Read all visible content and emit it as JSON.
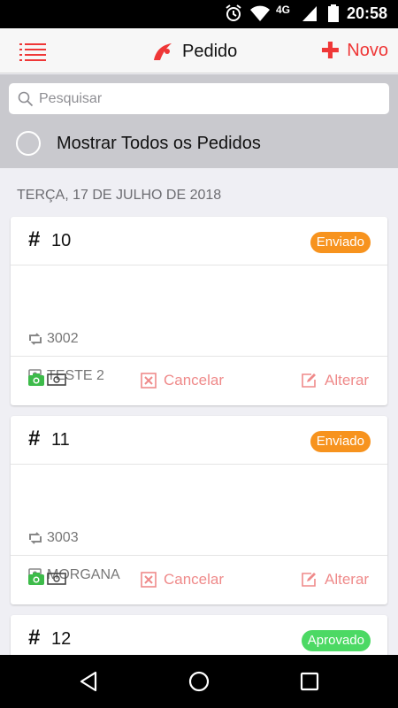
{
  "status_bar": {
    "time": "20:58",
    "network": "4G"
  },
  "nav": {
    "title": "Pedido",
    "new_label": "Novo"
  },
  "search": {
    "placeholder": "Pesquisar"
  },
  "toggle": {
    "label": "Mostrar Todos os Pedidos"
  },
  "date_header": "TERÇA, 17 DE JULHO DE 2018",
  "orders": [
    {
      "hash": "#",
      "number": "10",
      "status": "Enviado",
      "status_color": "#f7931e",
      "code": "3002",
      "client": "TESTE 2",
      "cancel_label": "Cancelar",
      "edit_label": "Alterar"
    },
    {
      "hash": "#",
      "number": "11",
      "status": "Enviado",
      "status_color": "#f7931e",
      "code": "3003",
      "client": "MORGANA",
      "cancel_label": "Cancelar",
      "edit_label": "Alterar"
    },
    {
      "hash": "#",
      "number": "12",
      "status": "Aprovado",
      "status_color": "#4cd964"
    }
  ],
  "colors": {
    "accent": "#ef3737",
    "action": "#ef8a8a",
    "enviado": "#f7931e",
    "aprovado": "#4cd964",
    "camera": "#3dbb4a"
  },
  "icons": {
    "menu": "list-menu-icon",
    "logo": "app-logo-icon",
    "add": "plus-icon",
    "search": "search-icon",
    "code": "retweet-icon",
    "client": "contact-card-icon",
    "camera": "camera-icon",
    "money": "money-bill-icon",
    "cancel": "close-square-icon",
    "edit": "edit-icon",
    "back": "back-triangle-icon",
    "home": "home-circle-icon",
    "recent": "recent-square-icon"
  }
}
